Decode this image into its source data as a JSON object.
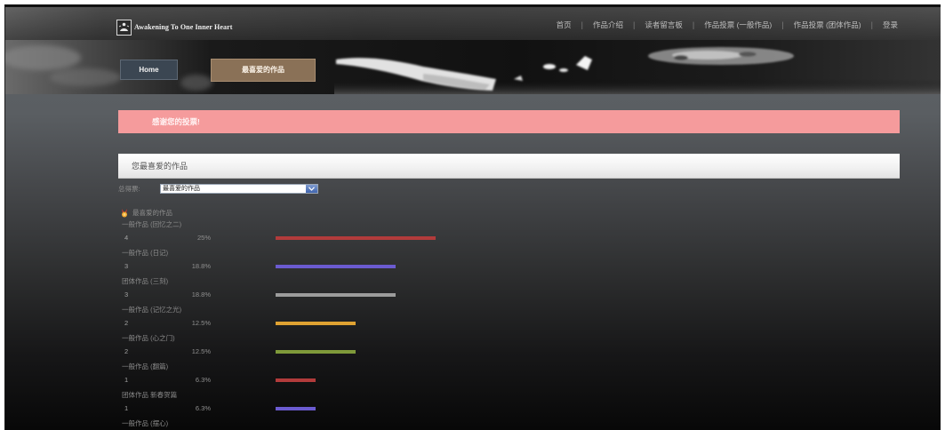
{
  "site": {
    "logo_text": "Awakening To One Inner Heart"
  },
  "nav": {
    "separator": "|",
    "items": [
      {
        "label": "首页"
      },
      {
        "label": "作品介绍"
      },
      {
        "label": "读者留言板"
      },
      {
        "label": "作品投票 (一般作品)"
      },
      {
        "label": "作品投票 (团体作品)"
      },
      {
        "label": "登录"
      }
    ]
  },
  "breadcrumb": {
    "home": "Home",
    "current": "最喜爱的作品"
  },
  "notice": {
    "text": "感谢您的投票!"
  },
  "panel": {
    "title": "您最喜爱的作品"
  },
  "filter": {
    "label": "总得票:",
    "selected": "最喜爱的作品"
  },
  "results": {
    "heading": "最喜爱的作品",
    "items": [
      {
        "label": "一般作品 (回忆之二)",
        "votes": 4,
        "percent": "25%",
        "color": "#b23b3b"
      },
      {
        "label": "一般作品 (日记)",
        "votes": 3,
        "percent": "18.8%",
        "color": "#6b5bd0"
      },
      {
        "label": "团体作品 (三刻)",
        "votes": 3,
        "percent": "18.8%",
        "color": "#9c9c9c"
      },
      {
        "label": "一般作品 (记忆之光)",
        "votes": 2,
        "percent": "12.5%",
        "color": "#e0a232"
      },
      {
        "label": "一般作品 (心之门)",
        "votes": 2,
        "percent": "12.5%",
        "color": "#7f9a3a"
      },
      {
        "label": "一般作品 (翻篇)",
        "votes": 1,
        "percent": "6.3%",
        "color": "#b23b3b"
      },
      {
        "label": "团体作品 新春贺篇",
        "votes": 1,
        "percent": "6.3%",
        "color": "#6b5bd0"
      },
      {
        "label": "一般作品 (摆心)"
      }
    ]
  },
  "colors": {
    "notice_bg": "#f59b9c",
    "tab_home_bg": "#3b4652",
    "tab_current_bg": "#8a7157",
    "select_arrow": "#3f64ad"
  },
  "icons": {
    "logo": "logo-icon",
    "medal": "medal-icon",
    "dropdown": "chevron-down-icon"
  }
}
